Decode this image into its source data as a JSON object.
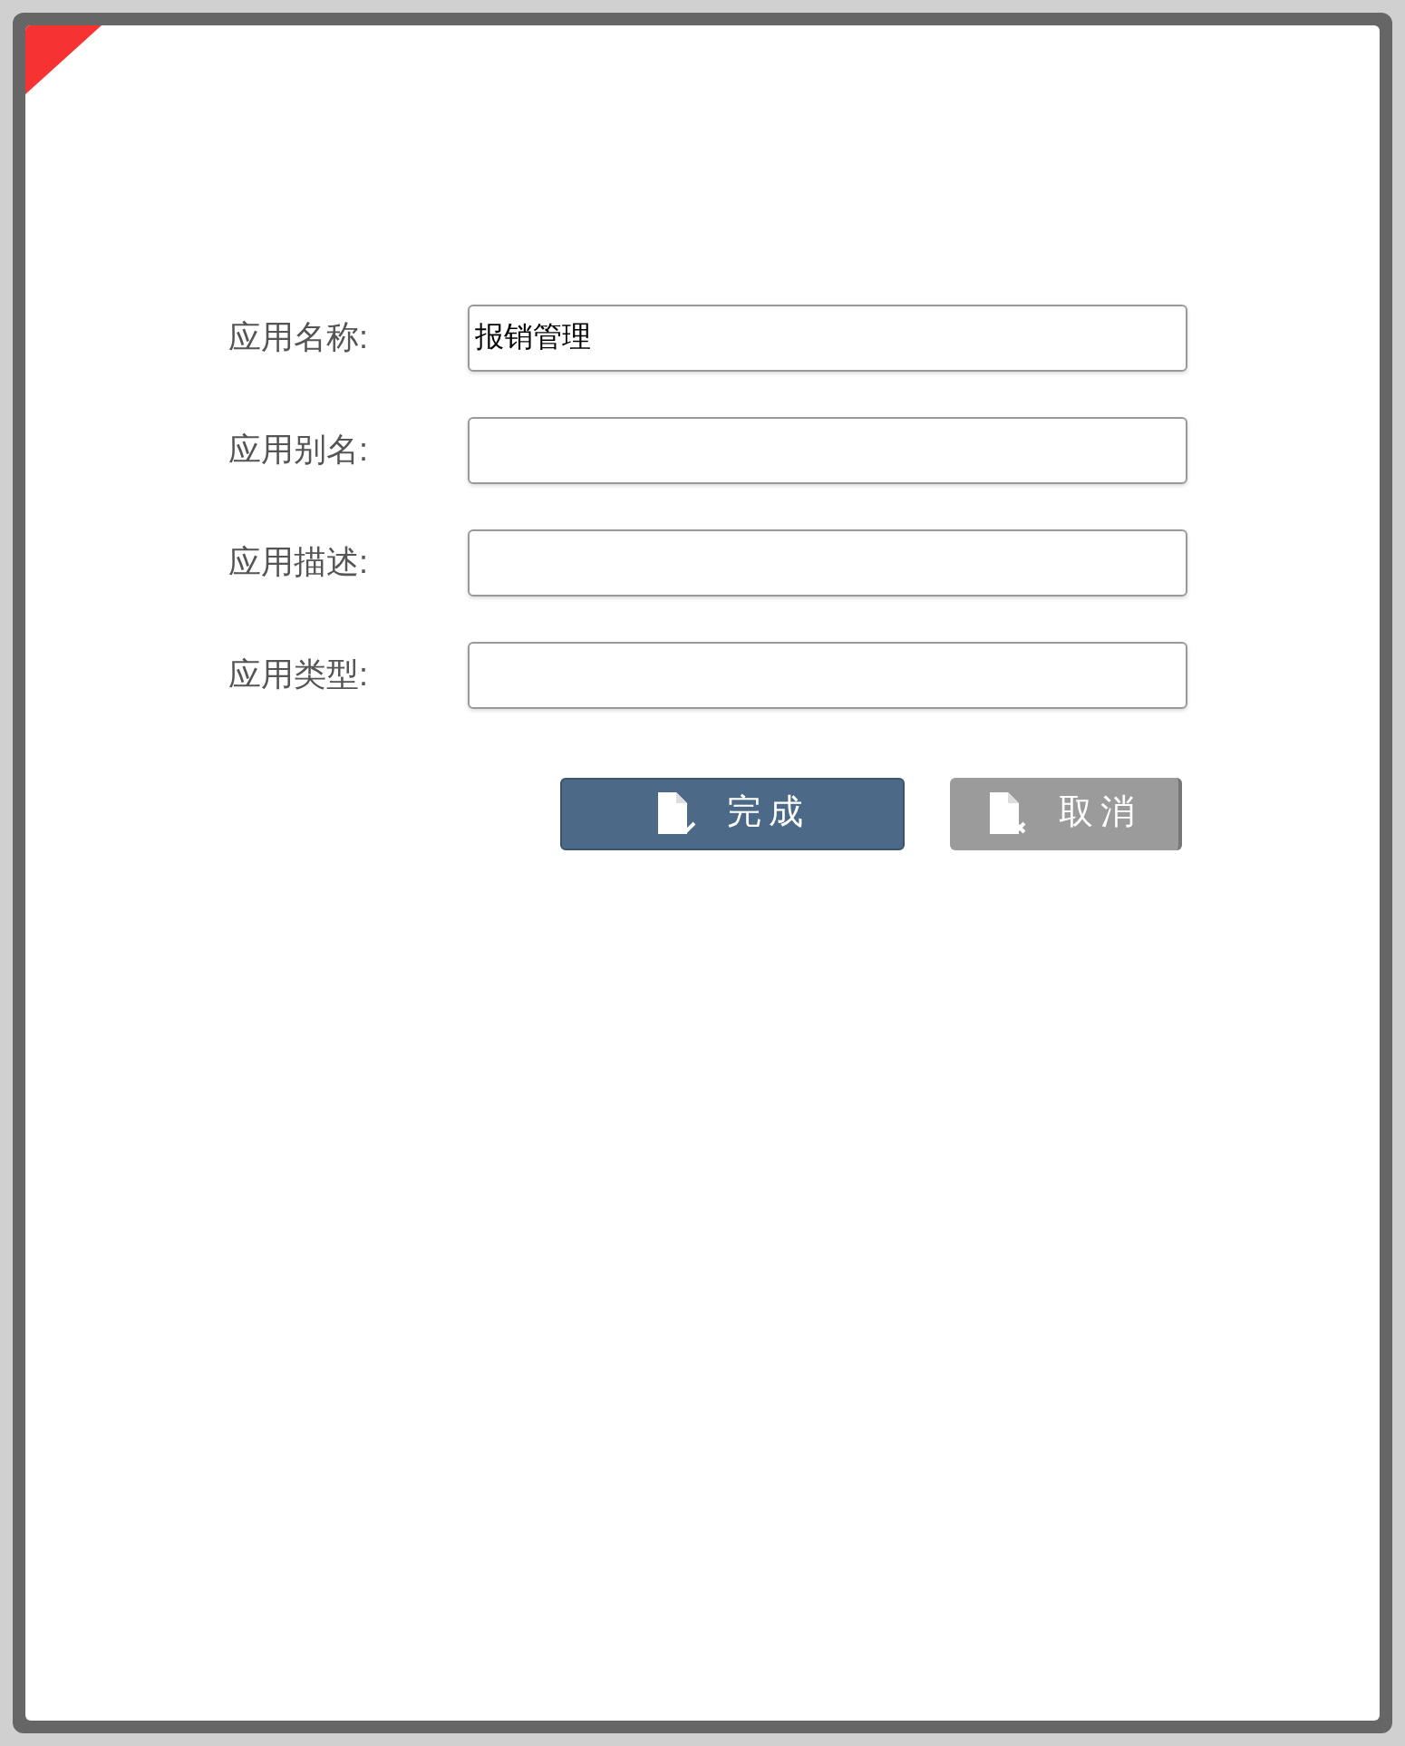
{
  "fields": [
    {
      "label": "应用名称:",
      "value": "报销管理"
    },
    {
      "label": "应用别名:"
    },
    {
      "label": "应用描述:"
    },
    {
      "label": "应用类型:"
    }
  ],
  "buttons": [
    {
      "label": "完成",
      "kind": "primary"
    },
    {
      "label": "取消",
      "kind": "secondary"
    }
  ]
}
